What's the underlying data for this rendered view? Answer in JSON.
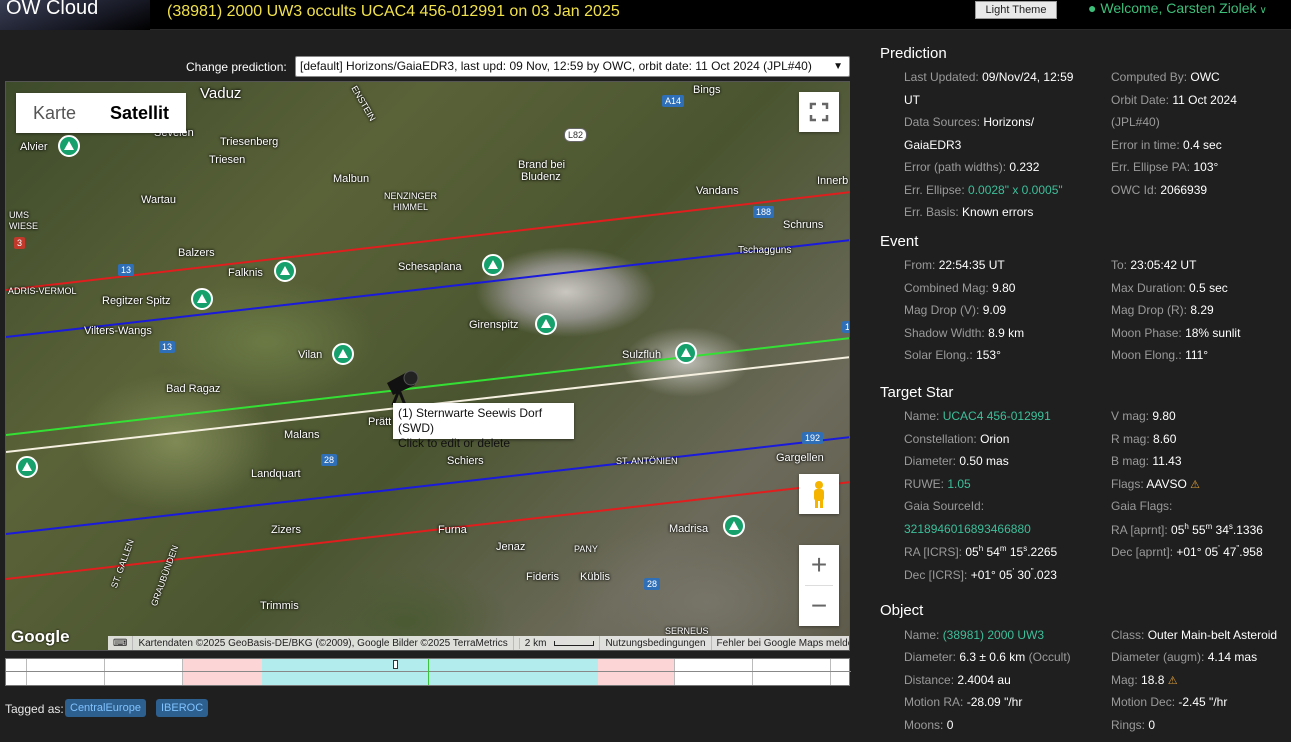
{
  "header": {
    "logo": "OW Cloud",
    "title": "(38981) 2000 UW3 occults UCAC4 456-012991 on 03 Jan 2025",
    "theme_button": "Light Theme",
    "welcome": "Welcome, Carsten Ziolek"
  },
  "prediction_selector": {
    "label": "Change prediction:",
    "selected": "[default] Horizons/GaiaEDR3, last upd: 09 Nov, 12:59 by OWC, orbit date: 11 Oct 2024 (JPL#40)"
  },
  "map": {
    "type_karte": "Karte",
    "type_satellit": "Satellit",
    "google": "Google",
    "attribution": "Kartendaten ©2025 GeoBasis-DE/BKG (©2009), Google Bilder ©2025 TerraMetrics",
    "scale": "2 km",
    "terms": "Nutzungsbedingungen",
    "report": "Fehler bei Google Maps melden",
    "tooltip_line1": "(1) Sternwarte Seewis Dorf (SWD)",
    "tooltip_line2": "Click to edit or delete",
    "places": {
      "vaduz": "Vaduz",
      "sevelen": "Sevelen",
      "alvier": "Alvier",
      "triesenberg": "Triesenberg",
      "triesen": "Triesen",
      "malbun": "Malbun",
      "nenzinger": "NENZINGER",
      "himmel": "HIMMEL",
      "brand": "Brand bei",
      "bludenz": "Bludenz",
      "bings": "Bings",
      "vandans": "Vandans",
      "innerb": "Innerb",
      "schruns": "Schruns",
      "tschagguns": "Tschagguns",
      "wartau": "Wartau",
      "ums": "UMS",
      "wiese": "WIESE",
      "balzers": "Balzers",
      "falknis": "Falknis",
      "schesaplana": "Schesaplana",
      "adris": "ADRIS-VERMOL",
      "regitzer": "Regitzer Spitz",
      "vilters": "Vilters-Wangs",
      "girenspitz": "Girenspitz",
      "vilan": "Vilan",
      "sulzfluh": "Sulzfluh",
      "badragaz": "Bad Ragaz",
      "pratt": "Prätt",
      "malans": "Malans",
      "schiers": "Schiers",
      "stantonien": "ST. ANTÖNIEN",
      "gargellen": "Gargellen",
      "landquart": "Landquart",
      "zizers": "Zizers",
      "furna": "Furna",
      "madrisa": "Madrisa",
      "jenaz": "Jenaz",
      "pany": "PANY",
      "fideris": "Fideris",
      "kublis": "Küblis",
      "trimmis": "Trimmis",
      "serneus": "SERNEUS",
      "stgallen": "ST. GALLEN",
      "graubunden": "GRAUBÜNDEN",
      "esteinL": "ENSTEIN"
    },
    "roads": {
      "a14": "A14",
      "l82": "L82",
      "r188": "188",
      "r3": "3",
      "r13a": "13",
      "r13b": "13",
      "r28": "28",
      "r28b": "28",
      "r28c": "28",
      "r192": "192",
      "r13c": "13"
    }
  },
  "tags": {
    "label": "Tagged as:",
    "items": [
      "CentralEurope",
      "IBEROC"
    ]
  },
  "prediction": {
    "title": "Prediction",
    "last_updated_k": "Last Updated:",
    "last_updated_v": "09/Nov/24, 12:59",
    "last_updated_v2": "UT",
    "computed_by_k": "Computed By:",
    "computed_by_v": "OWC",
    "data_sources_k": "Data Sources:",
    "data_sources_v": "Horizons/",
    "data_sources_v2": "GaiaEDR3",
    "orbit_date_k": "Orbit Date:",
    "orbit_date_v": "11 Oct 2024",
    "orbit_date_v2": "(JPL#40)",
    "error_path_k": "Error (path widths):",
    "error_path_v": "0.232",
    "error_time_k": "Error in time:",
    "error_time_v": "0.4 sec",
    "err_ellipse_k": "Err. Ellipse:",
    "err_ellipse_v": "0.0028\" x 0.0005\"",
    "err_pa_k": "Err. Ellipse PA:",
    "err_pa_v": "103°",
    "err_basis_k": "Err. Basis:",
    "err_basis_v": "Known errors",
    "owc_id_k": "OWC Id:",
    "owc_id_v": "2066939"
  },
  "event": {
    "title": "Event",
    "from_k": "From:",
    "from_v": "22:54:35 UT",
    "to_k": "To:",
    "to_v": "23:05:42 UT",
    "cmag_k": "Combined Mag:",
    "cmag_v": "9.80",
    "maxdur_k": "Max Duration:",
    "maxdur_v": "0.5 sec",
    "mdv_k": "Mag Drop (V):",
    "mdv_v": "9.09",
    "mdr_k": "Mag Drop (R):",
    "mdr_v": "8.29",
    "shadow_k": "Shadow Width:",
    "shadow_v": "8.9 km",
    "moonphase_k": "Moon Phase:",
    "moonphase_v": "18% sunlit",
    "solar_k": "Solar Elong.:",
    "solar_v": "153°",
    "moonel_k": "Moon Elong.:",
    "moonel_v": "111°"
  },
  "target": {
    "title": "Target Star",
    "name_k": "Name:",
    "name_v": "UCAC4 456-012991",
    "vmag_k": "V mag:",
    "vmag_v": "9.80",
    "const_k": "Constellation:",
    "const_v": "Orion",
    "rmag_k": "R mag:",
    "rmag_v": "8.60",
    "diam_k": "Diameter:",
    "diam_v": "0.50 mas",
    "bmag_k": "B mag:",
    "bmag_v": "11.43",
    "ruwe_k": "RUWE:",
    "ruwe_v": "1.05",
    "flags_k": "Flags:",
    "flags_v": "AAVSO",
    "gaia_k": "Gaia SourceId:",
    "gaia_v": "3218946016893466880",
    "gaiaflags_k": "Gaia Flags:",
    "ra_aprnt_k": "RA [aprnt]:",
    "ra_icrs_k": "RA [ICRS]:",
    "dec_aprnt_k": "Dec [aprnt]:",
    "dec_icrs_k": "Dec [ICRS]:"
  },
  "object": {
    "title": "Object",
    "name_k": "Name:",
    "name_v": "(38981) 2000 UW3",
    "class_k": "Class:",
    "class_v": "Outer Main-belt Asteroid",
    "diam_k": "Diameter:",
    "diam_v": "6.3 ± 0.6 km",
    "diam_note": "(Occult)",
    "diam_augm_k": "Diameter (augm):",
    "diam_augm_v": "4.14 mas",
    "dist_k": "Distance:",
    "dist_v": "2.4004 au",
    "mag_k": "Mag:",
    "mag_v": "18.8",
    "mra_k": "Motion RA:",
    "mra_v": "-28.09 \"/hr",
    "mdec_k": "Motion Dec:",
    "mdec_v": "-2.45 \"/hr",
    "moons_k": "Moons:",
    "moons_v": "0",
    "rings_k": "Rings:",
    "rings_v": "0"
  },
  "colors": {
    "title_yellow": "#f1e14a",
    "accent_green": "#3dbf7a",
    "path_red": "#e01e1e",
    "path_blue": "#1a1adc",
    "path_green": "#35e035",
    "path_white": "#f5f0e0"
  }
}
